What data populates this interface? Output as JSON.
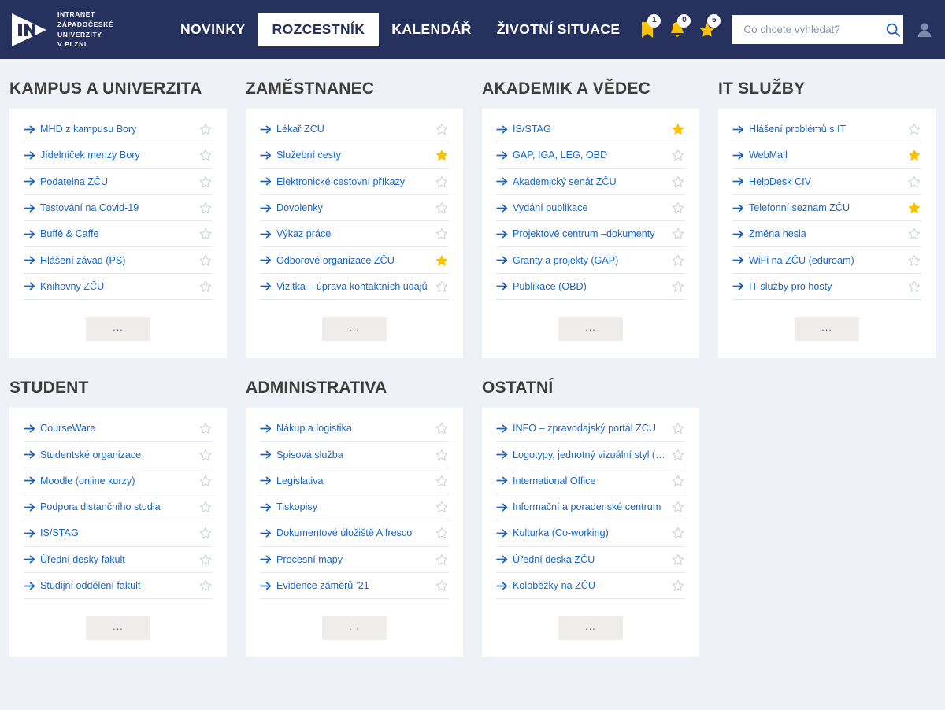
{
  "header": {
    "logo": {
      "icon": "in-play-arrow-logo",
      "lines": [
        "INTRANET",
        "ZÁPADOČESKÉ",
        "UNIVERZITY",
        "V PLZNI"
      ]
    },
    "nav": [
      {
        "label": "NOVINKY",
        "active": false
      },
      {
        "label": "ROZCESTNÍK",
        "active": true
      },
      {
        "label": "KALENDÁŘ",
        "active": false
      },
      {
        "label": "ŽIVOTNÍ SITUACE",
        "active": false
      }
    ],
    "badges": [
      {
        "icon": "bookmark-icon",
        "count": "1"
      },
      {
        "icon": "bell-icon",
        "count": "0"
      },
      {
        "icon": "star-icon",
        "count": "5"
      }
    ],
    "search": {
      "placeholder": "Co chcete vyhledat?",
      "value": "",
      "icon": "search-icon"
    },
    "avatar": {
      "icon": "user-icon"
    }
  },
  "colors": {
    "header_bg": "#26315e",
    "page_bg": "#eef2f7",
    "link_blue": "#1a66c4",
    "star_active": "#fcc200",
    "star_inactive": "#cfd3da",
    "card_bg": "#ffffff",
    "title_gray": "#3c3c3c"
  },
  "more_label": "...",
  "sections": [
    {
      "title": "KAMPUS A UNIVERZITA",
      "items": [
        {
          "label": "MHD z kampusu Bory",
          "starred": false
        },
        {
          "label": "Jídelníček menzy Bory",
          "starred": false
        },
        {
          "label": "Podatelna ZČU",
          "starred": false
        },
        {
          "label": "Testování na Covid-19",
          "starred": false
        },
        {
          "label": "Buffé & Caffe",
          "starred": false
        },
        {
          "label": "Hlášení závad (PS)",
          "starred": false
        },
        {
          "label": "Knihovny ZČU",
          "starred": false
        }
      ]
    },
    {
      "title": "ZAMĚSTNANEC",
      "items": [
        {
          "label": "Lékař ZČU",
          "starred": false
        },
        {
          "label": "Služební cesty",
          "starred": true
        },
        {
          "label": "Elektronické cestovní příkazy",
          "starred": false
        },
        {
          "label": "Dovolenky",
          "starred": false
        },
        {
          "label": "Výkaz práce",
          "starred": false
        },
        {
          "label": "Odborové organizace ZČU",
          "starred": true
        },
        {
          "label": "Vizitka – úprava kontaktních údajů",
          "starred": false
        }
      ]
    },
    {
      "title": "AKADEMIK A VĚDEC",
      "items": [
        {
          "label": "IS/STAG",
          "starred": true
        },
        {
          "label": "GAP, IGA, LEG, OBD",
          "starred": false
        },
        {
          "label": "Akademický senát ZČU",
          "starred": false
        },
        {
          "label": "Vydání publikace",
          "starred": false
        },
        {
          "label": "Projektové centrum –dokumenty",
          "starred": false
        },
        {
          "label": "Granty a projekty (GAP)",
          "starred": false
        },
        {
          "label": "Publikace (OBD)",
          "starred": false
        }
      ]
    },
    {
      "title": "IT SLUŽBY",
      "items": [
        {
          "label": "Hlášení problémů s IT",
          "starred": false
        },
        {
          "label": "WebMail",
          "starred": true
        },
        {
          "label": "HelpDesk CIV",
          "starred": false
        },
        {
          "label": "Telefonní seznam ZČU",
          "starred": true
        },
        {
          "label": "Změna hesla",
          "starred": false
        },
        {
          "label": "WiFi na ZČU (eduroam)",
          "starred": false
        },
        {
          "label": "IT služby pro hosty",
          "starred": false
        }
      ]
    },
    {
      "title": "STUDENT",
      "items": [
        {
          "label": "CourseWare",
          "starred": false
        },
        {
          "label": "Studentské organizace",
          "starred": false
        },
        {
          "label": "Moodle (online kurzy)",
          "starred": false
        },
        {
          "label": "Podpora distančního studia",
          "starred": false
        },
        {
          "label": "IS/STAG",
          "starred": false
        },
        {
          "label": "Úřední desky fakult",
          "starred": false
        },
        {
          "label": "Studijní oddělení fakult",
          "starred": false
        }
      ]
    },
    {
      "title": "ADMINISTRATIVA",
      "items": [
        {
          "label": "Nákup a logistika",
          "starred": false
        },
        {
          "label": "Spisová služba",
          "starred": false
        },
        {
          "label": "Legislativa",
          "starred": false
        },
        {
          "label": "Tiskopisy",
          "starred": false
        },
        {
          "label": "Dokumentové úložiště Alfresco",
          "starred": false
        },
        {
          "label": "Procesní mapy",
          "starred": false
        },
        {
          "label": "Evidence záměrů ’21",
          "starred": false
        }
      ]
    },
    {
      "title": "OSTATNÍ",
      "items": [
        {
          "label": "INFO – zpravodajský portál ZČU",
          "starred": false
        },
        {
          "label": "Logotypy, jednotný vizuální styl (JVS)",
          "starred": false
        },
        {
          "label": "International Office",
          "starred": false
        },
        {
          "label": "Informační a poradenské centrum",
          "starred": false
        },
        {
          "label": "Kulturka (Co-working)",
          "starred": false
        },
        {
          "label": "Úřední deska ZČU",
          "starred": false
        },
        {
          "label": "Koloběžky na ZČU",
          "starred": false
        }
      ]
    }
  ]
}
